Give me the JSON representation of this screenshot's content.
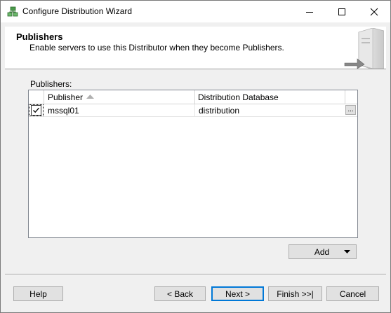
{
  "window": {
    "title": "Configure Distribution Wizard",
    "icon": "wizard-icon"
  },
  "titlebar_buttons": [
    "minimize-icon",
    "maximize-icon",
    "close-icon"
  ],
  "header": {
    "title": "Publishers",
    "subtitle": "Enable servers to use this Distributor when they become Publishers."
  },
  "publishers": {
    "label": "Publishers:",
    "columns": [
      "Publisher",
      "Distribution Database"
    ],
    "sort_column": "Publisher",
    "sort_direction": "ascending",
    "rows": [
      {
        "checked": true,
        "publisher": "mssql01",
        "database": "distribution",
        "browse_label": "..."
      }
    ]
  },
  "add_button": {
    "label": "Add"
  },
  "footer": {
    "help": "Help",
    "back": "< Back",
    "next": "Next >",
    "finish": "Finish >>|",
    "cancel": "Cancel"
  },
  "colors": {
    "accent": "#0078d7",
    "dialog_bg": "#f0f0f0",
    "button_bg": "#e1e1e1"
  }
}
